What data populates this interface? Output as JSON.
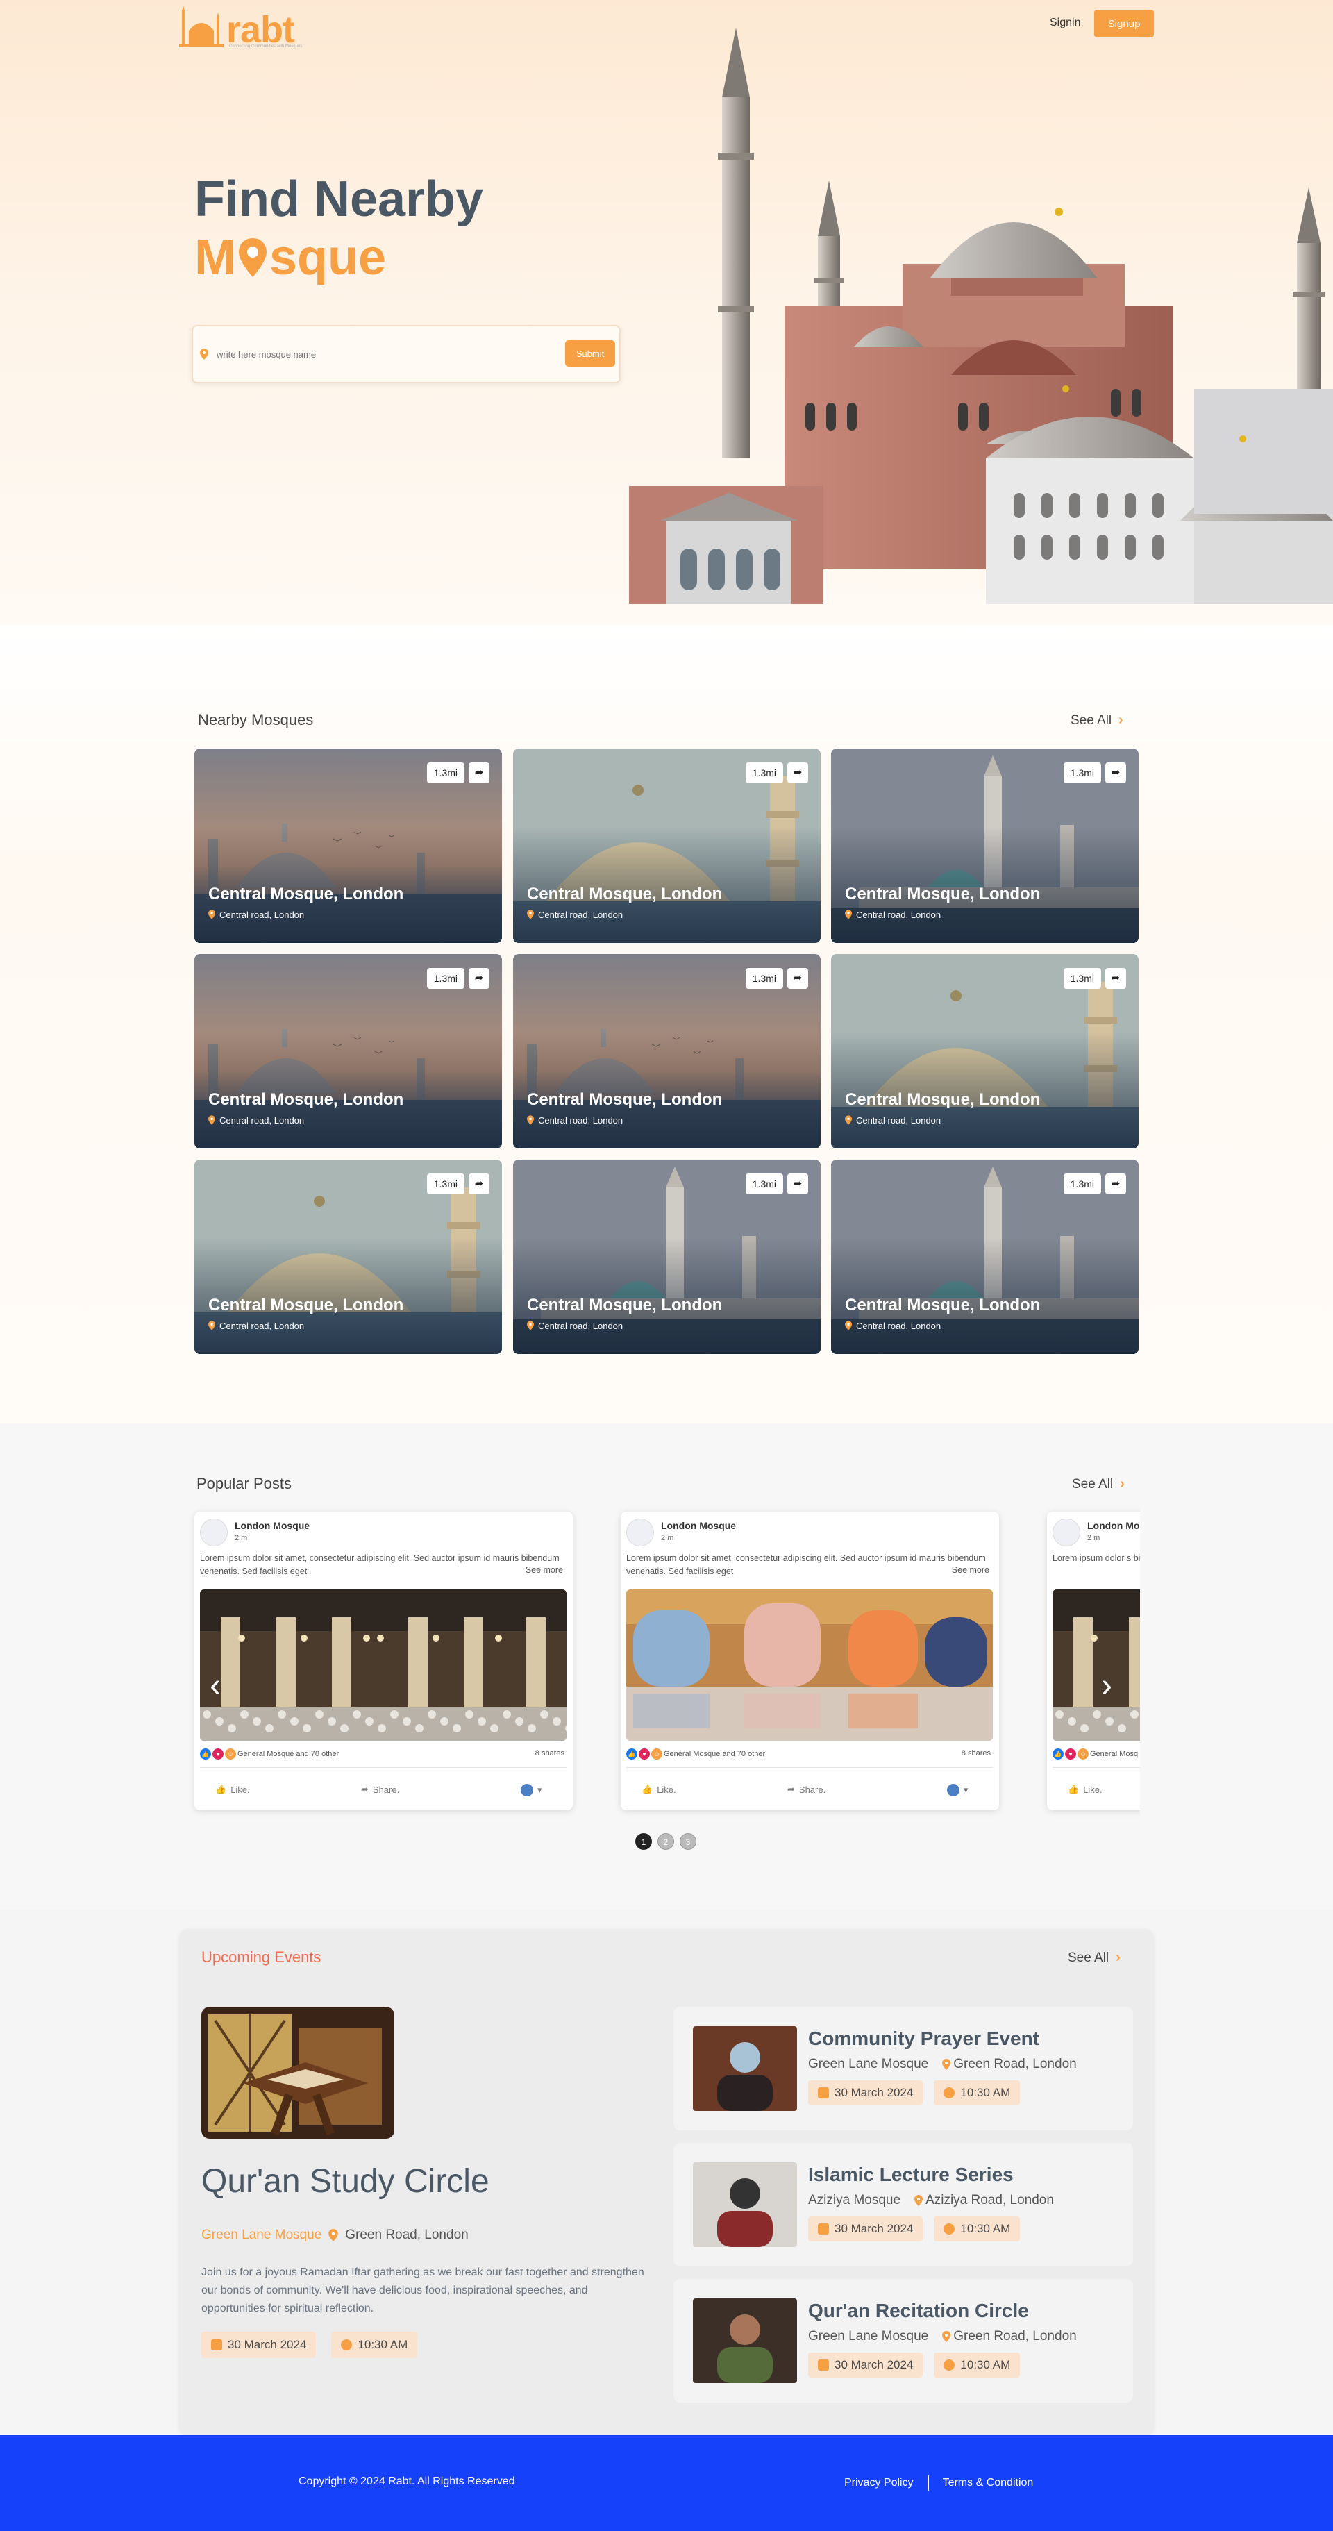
{
  "header": {
    "logo_text": "rabt",
    "logo_tagline": "Connecting Communities with Mosques",
    "signin": "Signin",
    "signup": "Signup"
  },
  "hero": {
    "title_line1": "Find Nearby",
    "title_line2_before": "M",
    "title_line2_after": "sque",
    "search_placeholder": "write here mosque name",
    "submit": "Submit"
  },
  "nearby": {
    "title": "Nearby Mosques",
    "see_all": "See All",
    "cards": [
      {
        "name": "Central Mosque, London",
        "address": "Central road, London",
        "distance": "1.3mi",
        "scene": "a"
      },
      {
        "name": "Central Mosque, London",
        "address": "Central road, London",
        "distance": "1.3mi",
        "scene": "b"
      },
      {
        "name": "Central Mosque, London",
        "address": "Central road, London",
        "distance": "1.3mi",
        "scene": "c"
      },
      {
        "name": "Central Mosque, London",
        "address": "Central road, London",
        "distance": "1.3mi",
        "scene": "a"
      },
      {
        "name": "Central Mosque, London",
        "address": "Central road, London",
        "distance": "1.3mi",
        "scene": "a"
      },
      {
        "name": "Central Mosque, London",
        "address": "Central road, London",
        "distance": "1.3mi",
        "scene": "b"
      },
      {
        "name": "Central Mosque, London",
        "address": "Central road, London",
        "distance": "1.3mi",
        "scene": "b"
      },
      {
        "name": "Central Mosque, London",
        "address": "Central road, London",
        "distance": "1.3mi",
        "scene": "c"
      },
      {
        "name": "Central Mosque, London",
        "address": "Central road, London",
        "distance": "1.3mi",
        "scene": "c"
      }
    ]
  },
  "posts": {
    "title": "Popular Posts",
    "see_all": "See All",
    "items": [
      {
        "author": "London Mosque",
        "time": "2 m",
        "text": "Lorem ipsum dolor sit amet, consectetur adipiscing elit. Sed auctor ipsum id mauris bibendum venenatis. Sed facilisis eget",
        "see_more": "See more",
        "reactions": "General Mosque and 70 other",
        "shares": "8 shares",
        "like": "Like.",
        "share": "Share."
      },
      {
        "author": "London Mosque",
        "time": "2 m",
        "text": "Lorem ipsum dolor sit amet, consectetur adipiscing elit. Sed auctor ipsum id mauris bibendum venenatis. Sed facilisis eget",
        "see_more": "See more",
        "reactions": "General Mosque and 70 other",
        "shares": "8 shares",
        "like": "Like.",
        "share": "Share."
      },
      {
        "author": "London Mo",
        "time": "2 m",
        "text": "Lorem ipsum dolor s bibendum venenatis.",
        "reactions": "General Mosq",
        "like": "Like."
      }
    ],
    "pages": [
      "1",
      "2",
      "3"
    ]
  },
  "events": {
    "title": "Upcoming Events",
    "see_all": "See All",
    "featured": {
      "title": "Qur'an Study Circle",
      "mosque": "Green Lane Mosque",
      "location": "Green Road, London",
      "description": "Join us for a joyous Ramadan Iftar gathering as we break our fast together and strengthen our bonds of community. We'll have delicious food, inspirational speeches, and opportunities for spiritual reflection.",
      "date": "30 March 2024",
      "time": "10:30 AM"
    },
    "list": [
      {
        "title": "Community Prayer Event",
        "mosque": "Green Lane Mosque",
        "location": "Green Road, London",
        "date": "30 March 2024",
        "time": "10:30 AM"
      },
      {
        "title": "Islamic Lecture Series",
        "mosque": "Aziziya Mosque",
        "location": "Aziziya Road, London",
        "date": "30 March 2024",
        "time": "10:30 AM"
      },
      {
        "title": "Qur'an Recitation Circle",
        "mosque": "Green Lane Mosque",
        "location": "Green Road, London",
        "date": "30 March 2024",
        "time": "10:30 AM"
      }
    ]
  },
  "footer": {
    "copyright": "Copyright © 2024 Rabt. All Rights Reserved",
    "privacy": "Privacy Policy",
    "terms": "Terms & Condition"
  },
  "colors": {
    "accent": "#f7a043",
    "footer": "#1641fb",
    "heading": "#4a5866",
    "events_title": "#f36b4f"
  }
}
